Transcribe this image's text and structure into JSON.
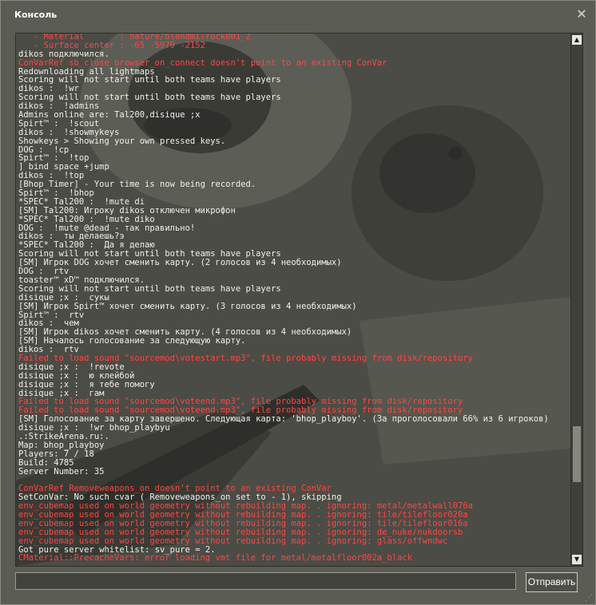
{
  "window": {
    "title": "Консоль"
  },
  "colors": {
    "window_bg": "#5b5c54",
    "log_bg": "#4b4c45",
    "text": "#f1f1ea",
    "error": "#ff4545"
  },
  "icons": {
    "close": "close-icon",
    "up": "arrow-up-icon",
    "down": "arrow-down-icon",
    "grip": "resize-grip-icon"
  },
  "log": [
    {
      "t": "   - Material       : nature/blendmilrock001_2",
      "c": "red"
    },
    {
      "t": "   - Surface center : -65 -5979 -2152",
      "c": "red"
    },
    {
      "t": "dikos подключился.",
      "c": "white"
    },
    {
      "t": "ConVarRef sb_close_browser_on_connect doesn't point to an existing ConVar",
      "c": "red"
    },
    {
      "t": "Redownloading all lightmaps",
      "c": "white"
    },
    {
      "t": "Scoring will not start until both teams have players",
      "c": "white"
    },
    {
      "t": "dikos :  !wr",
      "c": "white"
    },
    {
      "t": "Scoring will not start until both teams have players",
      "c": "white"
    },
    {
      "t": "dikos :  !admins",
      "c": "white"
    },
    {
      "t": "Admins online are: Tal200,disique ;x",
      "c": "white"
    },
    {
      "t": "Spirt™ :  !scout",
      "c": "white"
    },
    {
      "t": "dikos :  !showmykeys",
      "c": "white"
    },
    {
      "t": "Showkeys > Showing your own pressed keys.",
      "c": "white"
    },
    {
      "t": "DOG :  !cp",
      "c": "white"
    },
    {
      "t": "Spirt™ :  !top",
      "c": "white"
    },
    {
      "t": "] bind space +jump",
      "c": "white"
    },
    {
      "t": "dikos :  !top",
      "c": "white"
    },
    {
      "t": "[Bhop Timer] - Your time is now being recorded.",
      "c": "white"
    },
    {
      "t": "Spirt™ :  !bhop",
      "c": "white"
    },
    {
      "t": "*SPEC* Tal200 :  !mute di",
      "c": "white"
    },
    {
      "t": "[SM] Tal200: Игроку dikos отключен микрофон",
      "c": "white"
    },
    {
      "t": "*SPEC* Tal200 :  !mute diko",
      "c": "white"
    },
    {
      "t": "DOG :  !mute @dead - так правильно!",
      "c": "white"
    },
    {
      "t": "dikos :  ты делаешь?э",
      "c": "white"
    },
    {
      "t": "*SPEC* Tal200 :  Да я делаю",
      "c": "white"
    },
    {
      "t": "Scoring will not start until both teams have players",
      "c": "white"
    },
    {
      "t": "[SM] Игрок DOG хочет сменить карту. (2 голосов из 4 необходимых)",
      "c": "white"
    },
    {
      "t": "DOG :  rtv",
      "c": "white"
    },
    {
      "t": "toaster™ xD™ подключился.",
      "c": "white"
    },
    {
      "t": "Scoring will not start until both teams have players",
      "c": "white"
    },
    {
      "t": "disique ;x :  сукы",
      "c": "white"
    },
    {
      "t": "[SM] Игрок Spirt™ хочет сменить карту. (3 голосов из 4 необходимых)",
      "c": "white"
    },
    {
      "t": "Spirt™ :  rtv",
      "c": "white"
    },
    {
      "t": "dikos :  чем",
      "c": "white"
    },
    {
      "t": "[SM] Игрок dikos хочет сменить карту. (4 голосов из 4 необходимых)",
      "c": "white"
    },
    {
      "t": "[SM] Началось голосование за следующую карту.",
      "c": "white"
    },
    {
      "t": "dikos :  rtv",
      "c": "white"
    },
    {
      "t": "Failed to load sound \"sourcemod\\votestart.mp3\", file probably missing from disk/repository",
      "c": "red"
    },
    {
      "t": "disique ;x :  !revote",
      "c": "white"
    },
    {
      "t": "disique ;x :  ю клейбой",
      "c": "white"
    },
    {
      "t": "disique ;x :  я тебе помогу",
      "c": "white"
    },
    {
      "t": "disique ;x :  гам",
      "c": "white"
    },
    {
      "t": "Failed to load sound \"sourcemod\\voteend.mp3\", file probably missing from disk/repository",
      "c": "red"
    },
    {
      "t": "Failed to load sound \"sourcemod\\voteend.mp3\", file probably missing from disk/repository",
      "c": "red"
    },
    {
      "t": "[SM] Голосование за карту завершено. Следующая карта: 'bhop_playboy'. (За проголосовали 66% из 6 игроков)",
      "c": "white"
    },
    {
      "t": "disique ;x :  !wr bhop_playbyu",
      "c": "white"
    },
    {
      "t": ".:StrikeArena.ru:.",
      "c": "white"
    },
    {
      "t": "Map: bhop_playboy",
      "c": "white"
    },
    {
      "t": "Players: 7 / 18",
      "c": "white"
    },
    {
      "t": "Build: 4785",
      "c": "white"
    },
    {
      "t": "Server Number: 35",
      "c": "white"
    },
    {
      "t": "",
      "c": "white"
    },
    {
      "t": "ConVarRef Removeweapons_on doesn't point to an existing ConVar",
      "c": "red"
    },
    {
      "t": "SetConVar: No such cvar ( Removeweapons_on set to - 1), skipping",
      "c": "white"
    },
    {
      "t": "env_cubemap used on world geometry without rebuilding map. . ignoring: metal/metalwall076a",
      "c": "red"
    },
    {
      "t": "env_cubemap used on world geometry without rebuilding map. . ignoring: tile/tilefloor020a",
      "c": "red"
    },
    {
      "t": "env_cubemap used on world geometry without rebuilding map. . ignoring: tile/tilefloor016a",
      "c": "red"
    },
    {
      "t": "env_cubemap used on world geometry without rebuilding map. . ignoring: de_nuke/nukdoorsb",
      "c": "red"
    },
    {
      "t": "env_cubemap used on world geometry without rebuilding map. . ignoring: glass/offwndwc",
      "c": "red"
    },
    {
      "t": "Got pure server whitelist: sv_pure = 2.",
      "c": "white"
    },
    {
      "t": "CMaterial::PrecacheVars: error loading vmt file for metal/metalfloor002a_black",
      "c": "red"
    }
  ],
  "input": {
    "value": ""
  },
  "submit": {
    "label": "Отправить"
  }
}
